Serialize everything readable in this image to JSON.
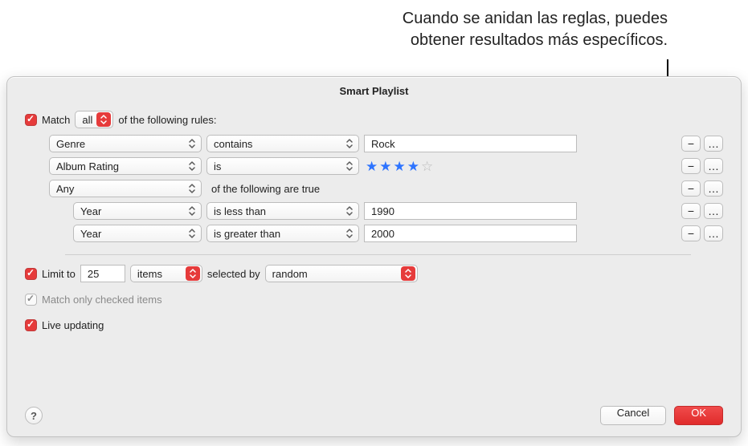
{
  "annotation": {
    "line1": "Cuando se anidan las reglas, puedes",
    "line2": "obtener resultados más específicos."
  },
  "dialog": {
    "title": "Smart Playlist",
    "match": {
      "prefix": "Match",
      "scope": "all",
      "suffix": "of the following rules:"
    },
    "rules": [
      {
        "indent": 1,
        "field": "Genre",
        "op": "contains",
        "value_text": "Rock"
      },
      {
        "indent": 1,
        "field": "Album Rating",
        "op": "is",
        "value_rating": 4,
        "value_max": 5
      },
      {
        "indent": 1,
        "nested_scope": "Any",
        "nested_text": "of the following are true"
      },
      {
        "indent": 2,
        "field": "Year",
        "op": "is less than",
        "value_text": "1990"
      },
      {
        "indent": 2,
        "field": "Year",
        "op": "is greater than",
        "value_text": "2000"
      }
    ],
    "rule_buttons": {
      "remove": "−",
      "more": "…"
    },
    "limit": {
      "label": "Limit to",
      "value": "25",
      "unit": "items",
      "by_label": "selected by",
      "by_value": "random"
    },
    "match_checked_label": "Match only checked items",
    "live_label": "Live updating",
    "help": "?",
    "buttons": {
      "cancel": "Cancel",
      "ok": "OK"
    },
    "state": {
      "match_checked": true,
      "limit_checked": true,
      "match_only_checked": true,
      "match_only_enabled": false,
      "live_checked": true
    }
  }
}
